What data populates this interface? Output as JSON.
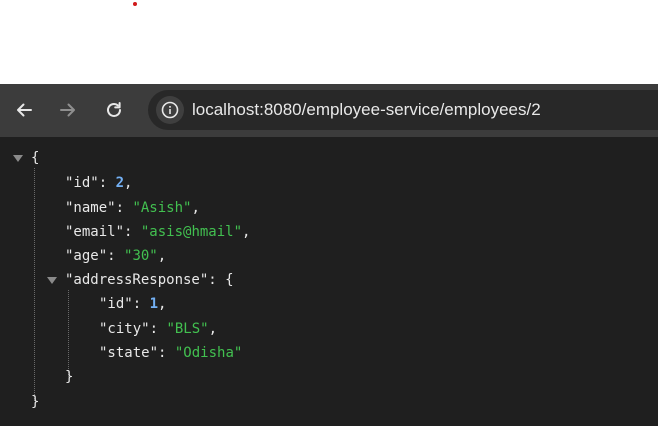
{
  "browser": {
    "url": "localhost:8080/employee-service/employees/2",
    "icons": [
      "back-arrow-icon",
      "forward-arrow-icon",
      "reload-icon",
      "info-icon"
    ]
  },
  "json_viewer": {
    "open_brace": "{",
    "close_brace": "}",
    "fields": [
      {
        "key": "\"id\"",
        "value": "2",
        "type": "number"
      },
      {
        "key": "\"name\"",
        "value": "\"Asish\"",
        "type": "string"
      },
      {
        "key": "\"email\"",
        "value": "\"asis@hmail\"",
        "type": "string"
      },
      {
        "key": "\"age\"",
        "value": "\"30\"",
        "type": "string"
      }
    ],
    "nested": {
      "key": "\"addressResponse\"",
      "open_brace": "{",
      "close_brace": "}",
      "fields": [
        {
          "key": "\"id\"",
          "value": "1",
          "type": "number"
        },
        {
          "key": "\"city\"",
          "value": "\"BLS\"",
          "type": "string"
        },
        {
          "key": "\"state\"",
          "value": "\"Odisha\"",
          "type": "string"
        }
      ]
    }
  },
  "colors": {
    "toolbar_bg": "#3c3c3c",
    "omnibox_bg": "#282828",
    "viewer_bg": "#1f1f1f",
    "number": "#73b0f4",
    "string": "#42c050"
  }
}
